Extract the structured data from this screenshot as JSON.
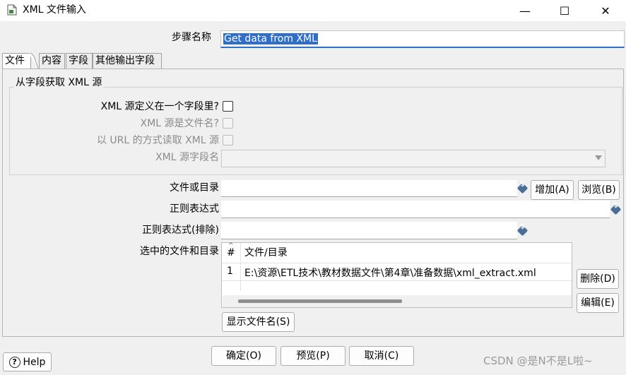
{
  "window": {
    "title": "XML 文件输入",
    "minimize_glyph": "—",
    "maximize_glyph": "☐",
    "close_glyph": "✕"
  },
  "step": {
    "label": "步骤名称",
    "value": "Get data from XML"
  },
  "tabs": [
    {
      "label": "文件"
    },
    {
      "label": "内容"
    },
    {
      "label": "字段"
    },
    {
      "label": "其他输出字段"
    }
  ],
  "xml_source_group": {
    "title": "从字段获取 XML 源",
    "defined_in_field_label": "XML 源定义在一个字段里?",
    "is_filename_label": "XML 源是文件名?",
    "read_as_url_label": "以 URL 的方式读取 XML 源",
    "field_name_label": "XML 源字段名"
  },
  "file": {
    "file_or_dir_label": "文件或目录",
    "file_or_dir_value": "",
    "regex_label": "正则表达式",
    "regex_value": "",
    "regex_exclude_label": "正则表达式(排除)",
    "regex_exclude_value": "",
    "add_button": "增加(A)",
    "browse_button": "浏览(B)"
  },
  "selected_files": {
    "label": "选中的文件和目录",
    "columns": [
      "#",
      "文件/目录"
    ],
    "rows": [
      {
        "index": "1",
        "path": "E:\\资源\\ETL技术\\教材数据文件\\第4章\\准备数据\\xml_extract.xml"
      }
    ],
    "delete_button": "删除(D)",
    "edit_button": "编辑(E)",
    "show_filenames_button": "显示文件名(S)"
  },
  "footer": {
    "help_label": "Help",
    "ok_button": "确定(O)",
    "preview_button": "预览(P)",
    "cancel_button": "取消(C)",
    "watermark": "CSDN @是N不是L啦~"
  }
}
